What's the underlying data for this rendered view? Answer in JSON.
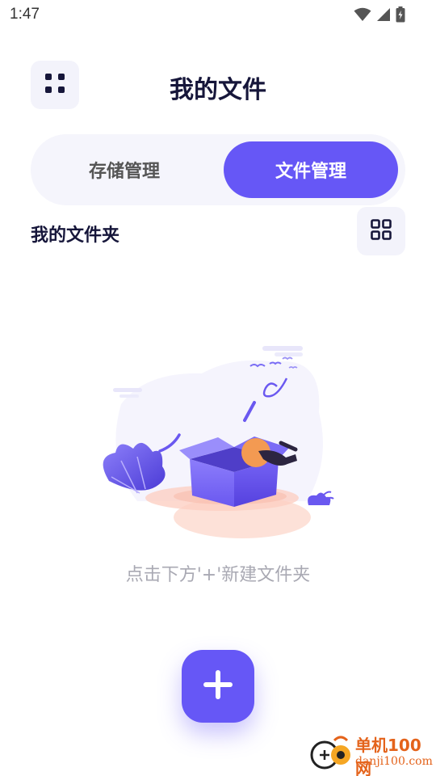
{
  "status_bar": {
    "time": "1:47",
    "icons": [
      "wifi-icon",
      "signal-icon",
      "battery-icon"
    ]
  },
  "header": {
    "title": "我的文件",
    "menu_icon": "grid-dots-icon"
  },
  "tabs": [
    {
      "label": "存储管理",
      "active": false
    },
    {
      "label": "文件管理",
      "active": true
    }
  ],
  "section": {
    "title": "我的文件夹",
    "view_toggle_icon": "grid-view-icon"
  },
  "empty_state": {
    "illustration": "empty-box-illustration",
    "hint": "点击下方'+'新建文件夹"
  },
  "fab": {
    "icon": "plus-icon"
  },
  "watermark": {
    "name": "单机100网",
    "url": "danji100.com"
  },
  "colors": {
    "accent": "#6657f6",
    "tab_bg": "#f5f5fc",
    "button_bg": "#f3f3fb",
    "hint_text": "#a9a9b3",
    "watermark": "#e4631b"
  }
}
